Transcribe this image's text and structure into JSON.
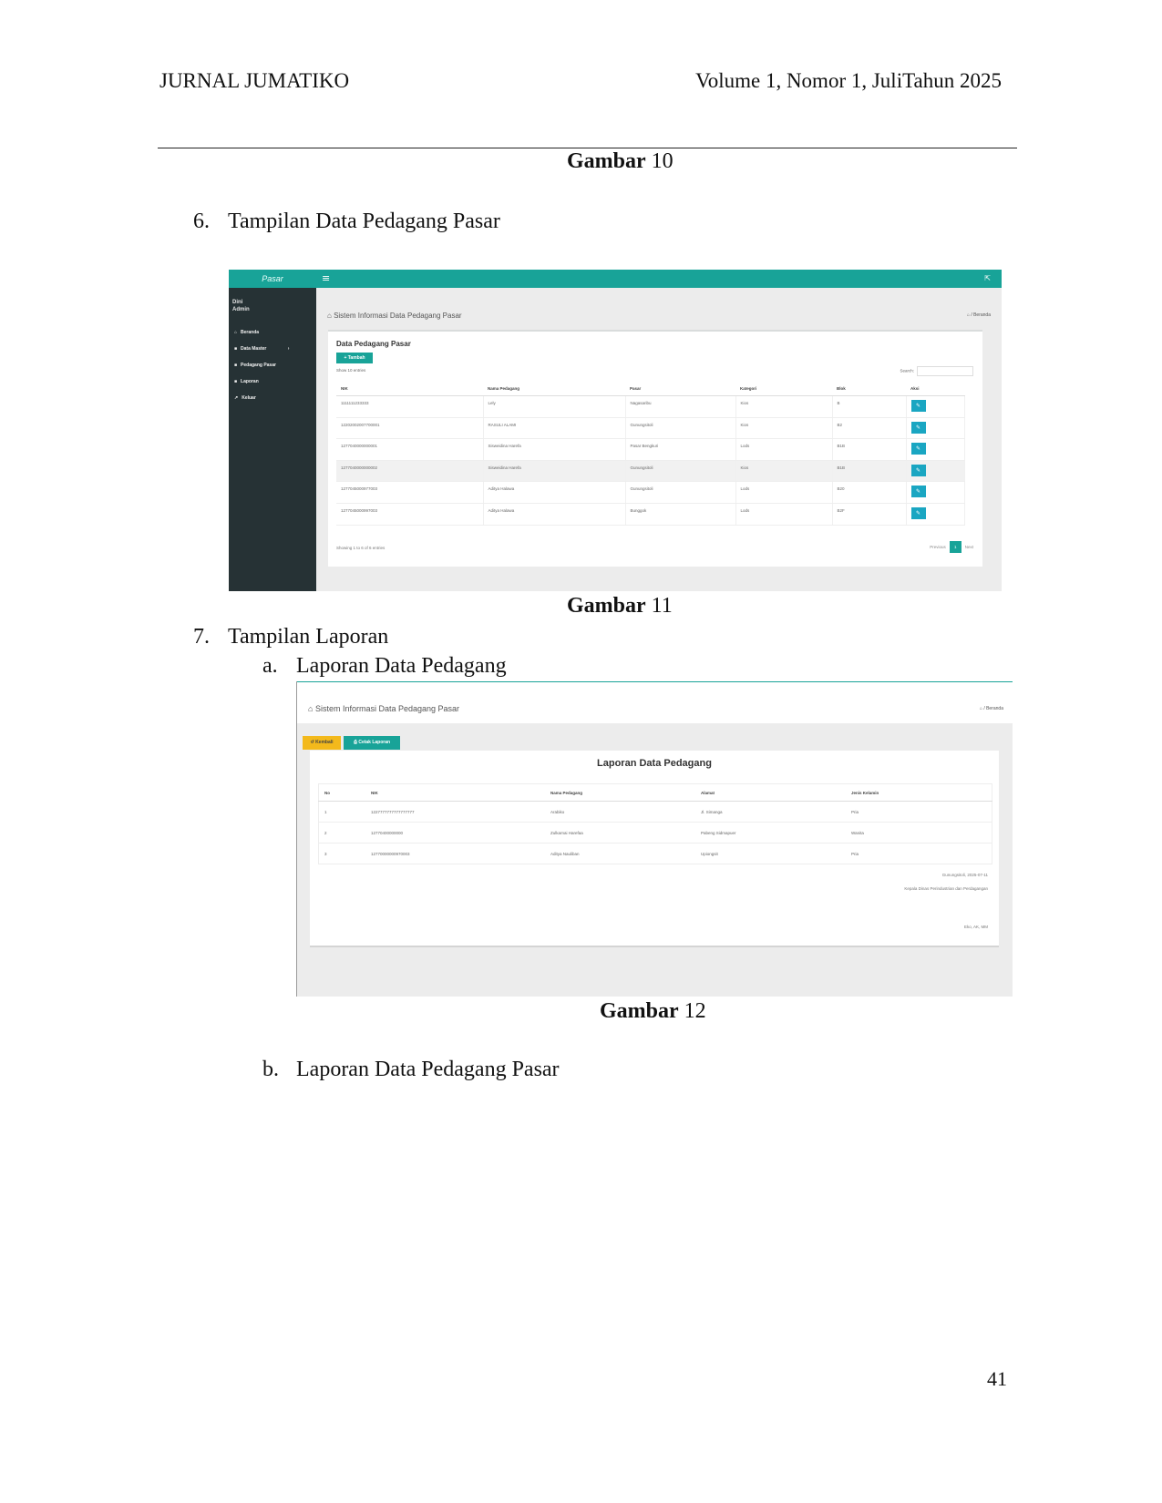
{
  "header": {
    "journal": "JURNAL JUMATIKO",
    "volume": "Volume 1, Nomor 1, JuliTahun 2025"
  },
  "captions": {
    "fig10_bold": "Gambar",
    "fig10_num": "10",
    "fig11_bold": "Gambar",
    "fig11_num": "11",
    "fig12_bold": "Gambar",
    "fig12_num": "12"
  },
  "list": {
    "item6_num": "6.",
    "item6_text": "Tampilan Data Pedagang Pasar",
    "item7_num": "7.",
    "item7_text": "Tampilan Laporan",
    "item7a_num": "a.",
    "item7a_text": "Laporan Data Pedagang",
    "item7b_num": "b.",
    "item7b_text": "Laporan Data Pedagang Pasar"
  },
  "figure11": {
    "brand": "Pasar",
    "user_name": "Dini",
    "user_role": "Admin",
    "menu": [
      {
        "icon": "home-icon",
        "glyph": "⌂",
        "label": "Beranda"
      },
      {
        "icon": "database-icon",
        "glyph": "■",
        "label": "Data Master"
      },
      {
        "icon": "user-icon",
        "glyph": "■",
        "label": "Pedagang Pasar"
      },
      {
        "icon": "report-icon",
        "glyph": "■",
        "label": "Laporan"
      },
      {
        "icon": "logout-icon",
        "glyph": "↗",
        "label": "Keluar"
      }
    ],
    "page_title": "Sistem Informasi Data Pedagang Pasar",
    "breadcrumb": "⌂ / Beranda",
    "card_title": "Data Pedagang Pasar",
    "add_button": "+ Tambah",
    "show_entries": "Show 10 entries",
    "search_label": "Search:",
    "columns": [
      "NIK",
      "Nama Pedagang",
      "Pasar",
      "Kategori",
      "Blok",
      "Aksi"
    ],
    "rows": [
      {
        "nik": "1111111233333",
        "nama": "Lely",
        "pasar": "Nagasaribu",
        "kategori": "Kios",
        "blok": "B"
      },
      {
        "nik": "12202002007700001",
        "nama": "RASULI ALAMI",
        "pasar": "Gunungsitoli",
        "kategori": "Kios",
        "blok": "B2"
      },
      {
        "nik": "1277040000000001",
        "nama": "Sisweidina Harefa",
        "pasar": "Pasar Bengkuri",
        "kategori": "Lods",
        "blok": "B1B"
      },
      {
        "nik": "1277040000000002",
        "nama": "Sisweidina Harefa",
        "pasar": "Gunungsitoli",
        "kategori": "Kios",
        "blok": "B1B"
      },
      {
        "nik": "1277045000977003",
        "nama": "Aditya Halawa",
        "pasar": "Gunungsitoli",
        "kategori": "Lods",
        "blok": "B20"
      },
      {
        "nik": "1277045000997003",
        "nama": "Aditya Halawa",
        "pasar": "Bunggok",
        "kategori": "Lods",
        "blok": "B2F"
      }
    ],
    "highlight_row": 3,
    "action_glyph": "✎",
    "showing": "Showing 1 to 6 of 6 entries",
    "prev": "Previous",
    "page": "1",
    "next": "Next"
  },
  "figure12": {
    "page_title": "Sistem Informasi Data Pedagang Pasar",
    "breadcrumb": "⌂ / Beranda",
    "back_button": "↺ Kembali",
    "print_button": "⎙ Cetak Laporan",
    "card_title": "Laporan Data Pedagang",
    "columns": [
      "No",
      "NIK",
      "Nama Pedagang",
      "Alamat",
      "Jenis Kelamin"
    ],
    "rows": [
      {
        "no": "1",
        "nik": "1227777777777777777",
        "nama": "Arabiko",
        "alamat": "Jl. Simanga",
        "jk": "Pria"
      },
      {
        "no": "2",
        "nik": "12770400000000",
        "nama": "Zulkarnai Harefaa",
        "alamat": "Pabeng Sidmapuer",
        "jk": "Wanita"
      },
      {
        "no": "3",
        "nik": "12770000000970003",
        "nama": "Aditya Nauliban",
        "alamat": "Upiongsit",
        "jk": "Pria"
      }
    ],
    "date": "Gunungsitoli, 2025-07-11",
    "signer_role": "Kepala Dinas Perindustrian dan Perdagangan",
    "signer_name": "Eko, AK, MM"
  },
  "page_number": "41"
}
